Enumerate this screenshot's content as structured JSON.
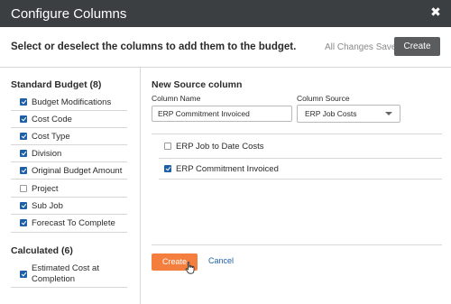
{
  "dialog": {
    "title": "Configure Columns",
    "close_icon": "close-icon"
  },
  "header": {
    "instruction": "Select or deselect the columns to add them to the budget.",
    "status": "All Changes Saved",
    "create_label": "Create"
  },
  "standard_budget": {
    "title": "Standard Budget (8)",
    "items": [
      {
        "label": "Budget Modifications",
        "checked": true
      },
      {
        "label": "Cost Code",
        "checked": true
      },
      {
        "label": "Cost Type",
        "checked": true
      },
      {
        "label": "Division",
        "checked": true
      },
      {
        "label": "Original Budget Amount",
        "checked": true
      },
      {
        "label": "Project",
        "checked": false
      },
      {
        "label": "Sub Job",
        "checked": true
      },
      {
        "label": "Forecast To Complete",
        "checked": true
      }
    ]
  },
  "calculated": {
    "title": "Calculated (6)",
    "items": [
      {
        "label_line1": "Estimated Cost at",
        "label_line2": "Completion",
        "checked": true
      }
    ]
  },
  "new_source": {
    "title": "New Source column",
    "column_name_label": "Column Name",
    "column_name_value": "ERP Commitment Invoiced",
    "column_source_label": "Column Source",
    "column_source_value": "ERP Job Costs",
    "options": [
      {
        "label": "ERP Job to Date Costs",
        "checked": false
      },
      {
        "label": "ERP Commitment Invoiced",
        "checked": true
      }
    ],
    "create_label": "Create",
    "cancel_label": "Cancel"
  },
  "colors": {
    "titlebar": "#3c3f42",
    "accent_blue": "#1f5fa8",
    "create_orange": "#f47e3e",
    "create_gray": "#5a5c5e"
  }
}
